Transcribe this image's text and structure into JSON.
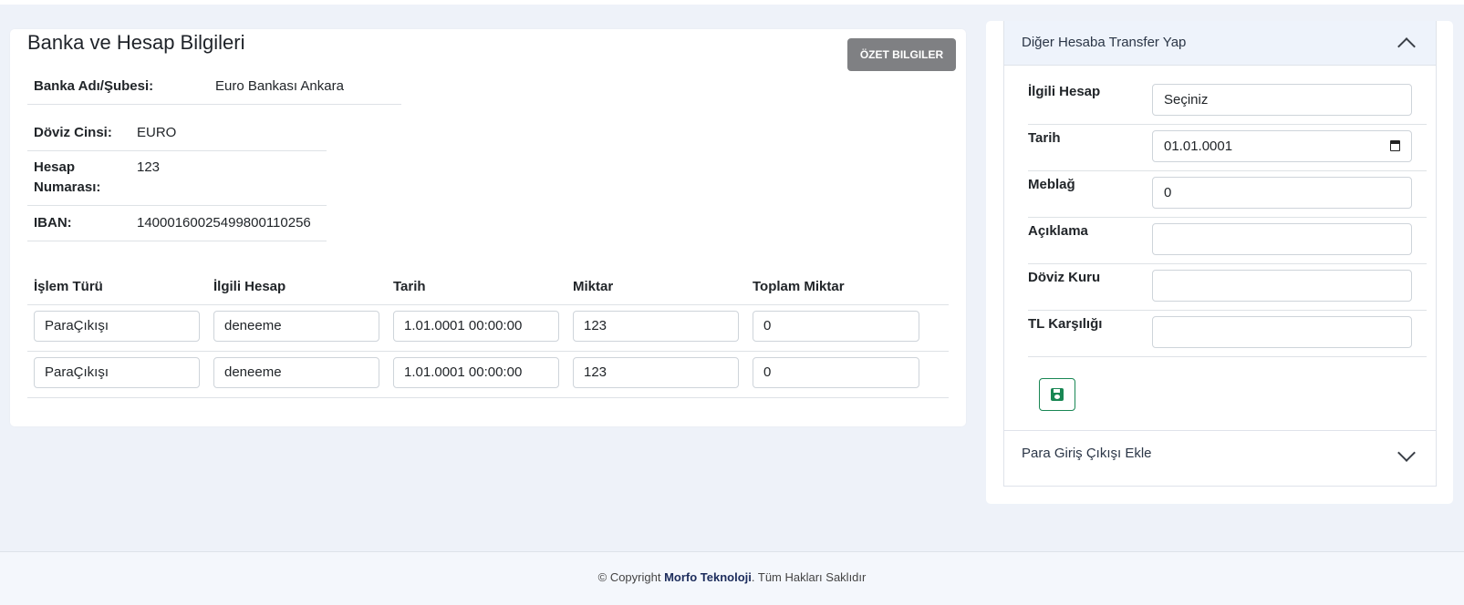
{
  "bank_card": {
    "title": "Banka ve Hesap Bilgileri",
    "summary_button": "ÖZET BILGILER",
    "bank_name_label": "Banka Adı/Şubesi:",
    "bank_name_value": "Euro Bankası Ankara",
    "currency_label": "Döviz Cinsi:",
    "currency_value": "EURO",
    "account_no_label_1": "Hesap",
    "account_no_label_2": "Numarası:",
    "account_no_value": "123",
    "iban_label": "IBAN:",
    "iban_value": "14000160025499800110256"
  },
  "transactions": {
    "headers": [
      "İşlem Türü",
      "İlgili Hesap",
      "Tarih",
      "Miktar",
      "Toplam Miktar"
    ],
    "rows": [
      [
        "ParaÇıkışı",
        "deneeme",
        "1.01.0001 00:00:00",
        "123",
        "0"
      ],
      [
        "ParaÇıkışı",
        "deneeme",
        "1.01.0001 00:00:00",
        "123",
        "0"
      ]
    ]
  },
  "transfer_panel": {
    "title": "Diğer Hesaba Transfer Yap",
    "fields": [
      {
        "label": "İlgili Hesap",
        "value": "Seçiniz"
      },
      {
        "label": "Tarih",
        "value": "01.01.0001"
      },
      {
        "label": "Meblağ",
        "value": "0"
      },
      {
        "label": "Açıklama",
        "value": ""
      },
      {
        "label": "Döviz Kuru",
        "value": ""
      },
      {
        "label": "TL Karşılığı",
        "value": ""
      }
    ],
    "save_icon": "floppy-disk-icon"
  },
  "cash_panel": {
    "title": "Para Giriş Çıkışı Ekle"
  },
  "footer": {
    "prefix": "© Copyright ",
    "company": "Morfo Teknoloji",
    "suffix": ". Tüm Hakları Saklıdır"
  },
  "colors": {
    "accent_green": "#198754",
    "summary_button_bg": "#7f8083",
    "page_bg": "#eef2f9"
  }
}
